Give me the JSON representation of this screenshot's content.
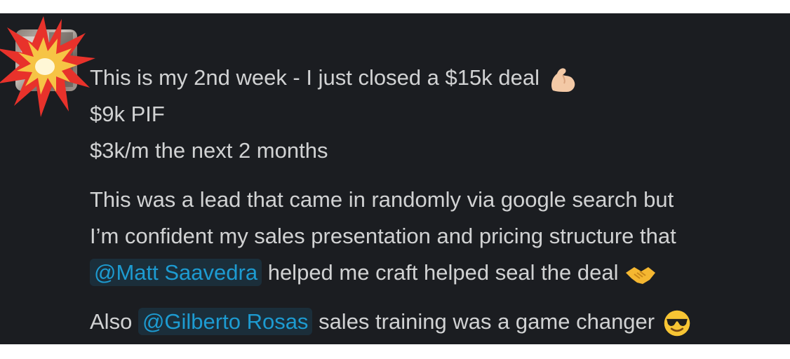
{
  "message": {
    "line1": "This is my 2nd week - I just closed a $15k deal",
    "line2": "$9k PIF",
    "line3": "$3k/m the next 2 months",
    "para2_line1": "This was a  lead that came in randomly via google search but",
    "para2_line2": "I’m confident my sales presentation and pricing structure that",
    "mention1": "@Matt Saavedra",
    "para2_line3_rest": "helped me craft helped seal the deal",
    "para3_prefix": "Also",
    "mention2": "@Gilberto Rosas",
    "para3_rest": "sales training was a game changer"
  },
  "emojis": {
    "muscle": "flexed-biceps-icon",
    "handshake": "handshake-icon",
    "cool": "sunglasses-face-icon",
    "explosion": "collision-burst-icon"
  }
}
